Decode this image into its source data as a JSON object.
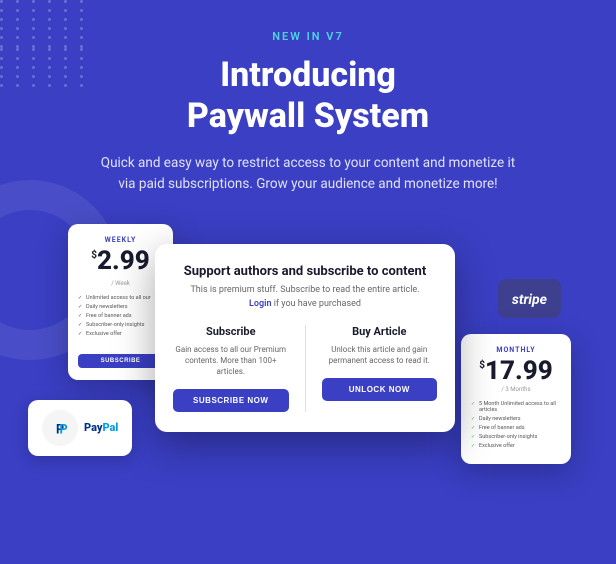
{
  "badge": "NEW IN V7",
  "main_title": "Introducing\nPaywall System",
  "subtitle": "Quick and easy way to restrict access to your content and monetize it via paid subscriptions. Grow your audience and monetize more!",
  "weekly_card": {
    "label": "WEEKLY",
    "currency": "$",
    "price": "2.99",
    "period": "/ Week",
    "features": [
      "Unlimited access to all our",
      "Daily newsletters",
      "Free of banner ads",
      "Subscriber-only insights",
      "Exclusive offer"
    ],
    "button_label": "SUBSCRIBE"
  },
  "modal": {
    "title": "Support authors and subscribe to content",
    "subtitle": "This is premium stuff. Subscribe to read the entire article.",
    "login_prefix": "Login",
    "login_suffix": "if you have purchased",
    "subscribe": {
      "title": "Subscribe",
      "desc": "Gain access to all our Premium contents. More than 100+ articles.",
      "button_label": "SUBSCRIBE NOW"
    },
    "buy_article": {
      "title": "Buy Article",
      "desc": "Unlock this article and gain permanent access to read it.",
      "button_label": "UNLOCK NOW"
    }
  },
  "stripe_badge": {
    "text": "stripe"
  },
  "paypal_badge": {
    "text": "PayPal"
  },
  "monthly_card": {
    "label": "MONTHLY",
    "currency": "$",
    "price": "17.99",
    "period": "/ 3 Months",
    "features": [
      "5 Month Unlimited access to all articles",
      "Daily newsletters",
      "Free of banner ads",
      "Subscriber-only insights",
      "Exclusive offer"
    ]
  },
  "colors": {
    "accent": "#3a3fc4",
    "cyan": "#4dd6e0"
  }
}
